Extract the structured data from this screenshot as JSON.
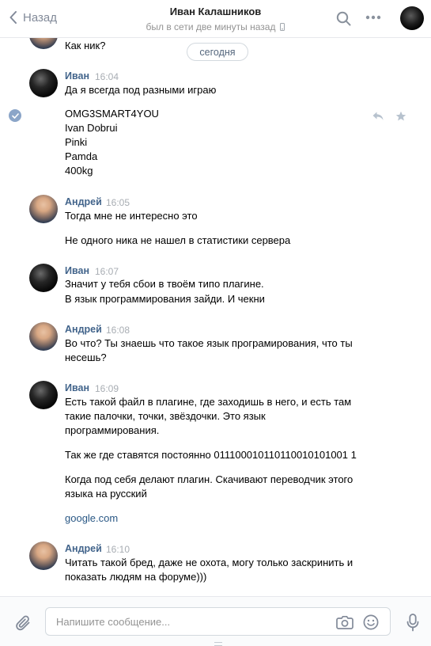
{
  "header": {
    "back_label": "Назад",
    "peer_name": "Иван Калашников",
    "peer_status": "был в сети две минуты назад"
  },
  "chat": {
    "date_label": "сегодня",
    "prev_line": "Как ник?",
    "messages": [
      {
        "author": "Иван",
        "time": "16:04",
        "lines": [
          "Да я всегда под разными играю",
          "",
          "OMG3SMART4YOU",
          "Ivan Dobrui",
          "Pinki",
          "Pamda",
          "400kg"
        ]
      },
      {
        "author": "Андрей",
        "time": "16:05",
        "lines": [
          "Тогда мне не интересно это",
          "",
          "Не одного ника не нашел в статистики сервера"
        ]
      },
      {
        "author": "Иван",
        "time": "16:07",
        "lines": [
          "Значит у тебя сбои в твоём типо плагине.",
          "В язык программирования зайди. И чекни"
        ]
      },
      {
        "author": "Андрей",
        "time": "16:08",
        "lines": [
          "Во что? Ты знаешь что такое язык програмирования, что ты",
          "несешь?"
        ]
      },
      {
        "author": "Иван",
        "time": "16:09",
        "lines": [
          "Есть такой файл в плагине, где заходишь в него, и есть там",
          "такие палочки, точки, звёздочки. Это язык",
          "программирования.",
          "",
          "Так же где ставятся постоянно 011100010110110010101001 1",
          "",
          "Когда под себя делают плагин. Скачивают переводчик этого",
          "языка на русский",
          "",
          "google.com"
        ]
      },
      {
        "author": "Андрей",
        "time": "16:10",
        "lines": [
          "Читать такой бред, даже не охота, могу только заскринить и",
          "показать людям на форуме)))"
        ]
      }
    ]
  },
  "composer": {
    "placeholder": "Напишите сообщение..."
  },
  "colors": {
    "accent": "#42648b",
    "link": "#2a5885",
    "muted": "#939393",
    "selected_check": "#8ba5c8"
  },
  "icons": [
    "back-chevron-icon",
    "search-icon",
    "more-icon",
    "mobile-icon",
    "check-icon",
    "reply-icon",
    "star-icon",
    "paperclip-icon",
    "camera-icon",
    "smile-icon",
    "microphone-icon"
  ]
}
